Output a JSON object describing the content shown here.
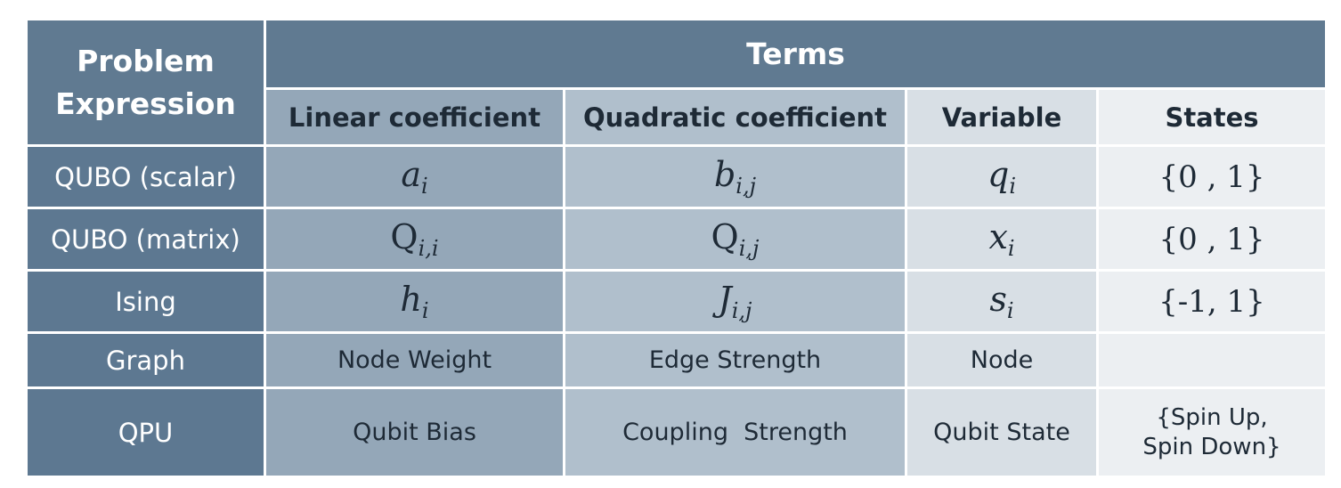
{
  "header": {
    "problem_line1": "Problem",
    "problem_line2": "Expression",
    "terms": "Terms",
    "columns": [
      "Linear coefficient",
      "Quadratic coefficient",
      "Variable",
      "States"
    ]
  },
  "rows": [
    {
      "label": "QUBO (scalar)",
      "linear": {
        "base": "a",
        "sub": "i"
      },
      "quadratic": {
        "base": "b",
        "sub": "i,j"
      },
      "variable": {
        "base": "q",
        "sub": "i"
      },
      "states": "{0 , 1}"
    },
    {
      "label": "QUBO (matrix)",
      "linear": {
        "base": "Q",
        "sub": "i,i"
      },
      "quadratic": {
        "base": "Q",
        "sub": "i,j"
      },
      "variable": {
        "base": "x",
        "sub": "i"
      },
      "states": "{0 , 1}"
    },
    {
      "label": "Ising",
      "linear": {
        "base": "h",
        "sub": "i"
      },
      "quadratic": {
        "base": "J",
        "sub": "i,j"
      },
      "variable": {
        "base": "s",
        "sub": "i"
      },
      "states": "{-1, 1}"
    },
    {
      "label": "Graph",
      "linear": "Node Weight",
      "quadratic": "Edge Strength",
      "variable": "Node",
      "states": ""
    },
    {
      "label": "QPU",
      "linear": "Qubit Bias",
      "quadratic": "Coupling  Strength",
      "variable": "Qubit State",
      "states_line1": "{Spin Up,",
      "states_line2": "Spin Down}"
    }
  ]
}
